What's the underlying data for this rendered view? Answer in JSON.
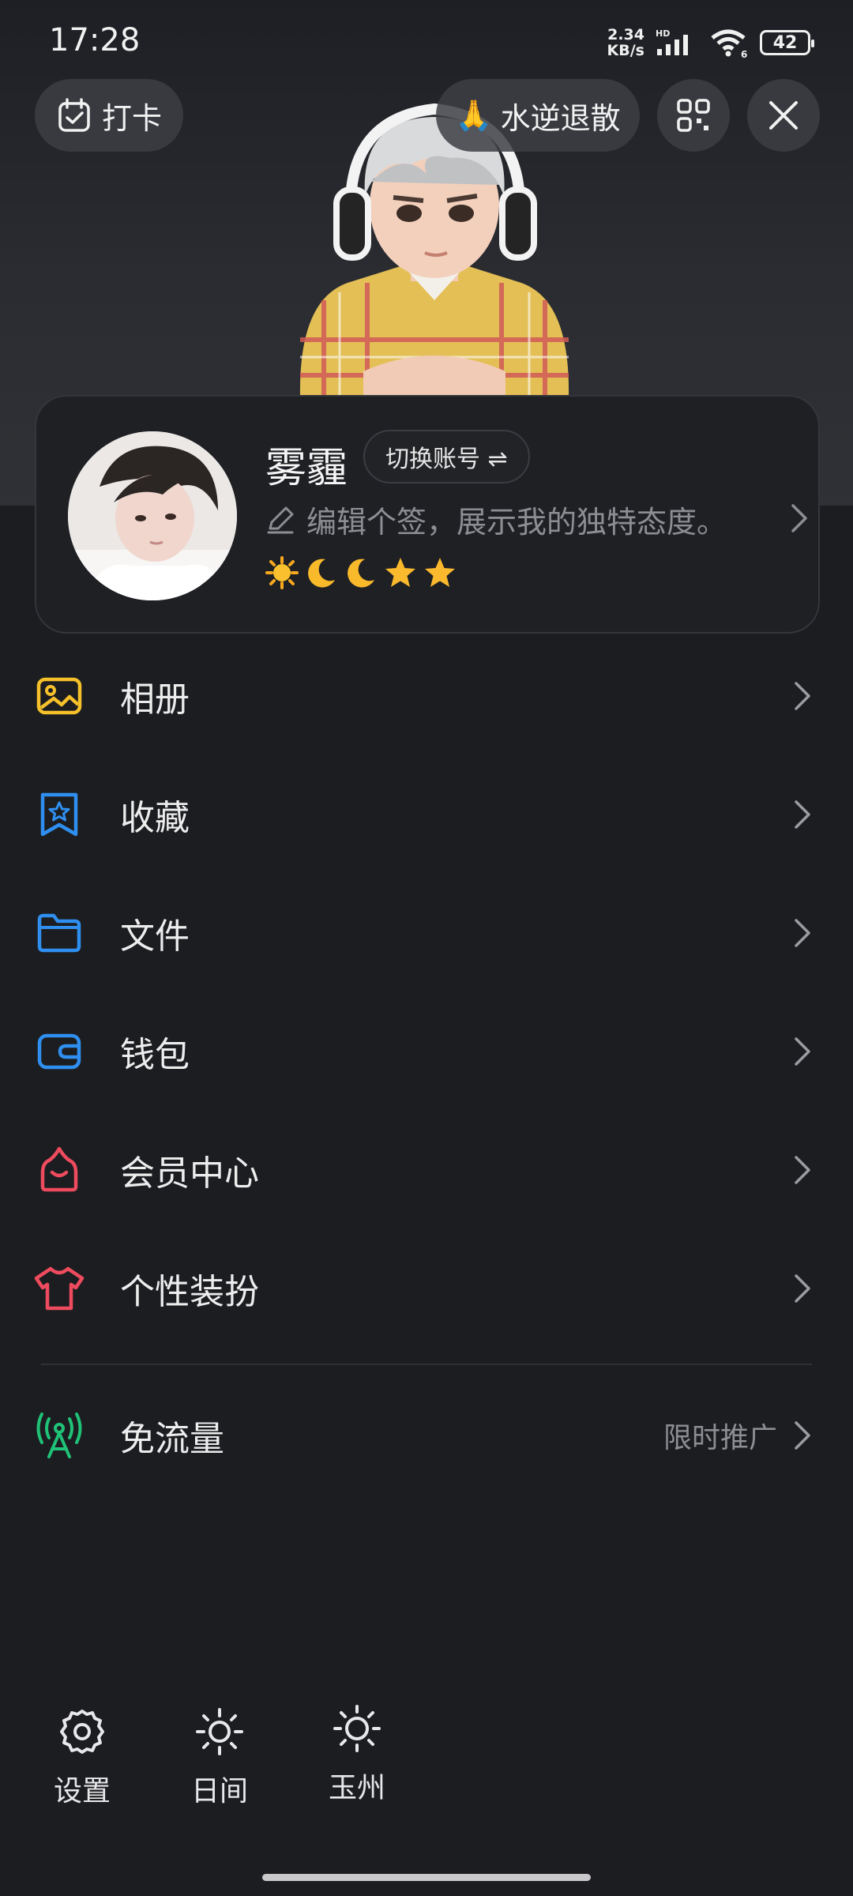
{
  "status_bar": {
    "time": "17:28",
    "net_speed_value": "2.34",
    "net_speed_unit": "KB/s",
    "hd": "HD",
    "wifi_num": "6",
    "battery": "42"
  },
  "top_actions": {
    "checkin_label": "打卡",
    "status_emoji": "🙏",
    "status_label": "水逆退散"
  },
  "profile": {
    "nickname": "雾霾",
    "switch_account_label": "切换账号 ⇌",
    "signature_placeholder": "编辑个签，展示我的独特态度。",
    "badges": [
      "sun",
      "moon",
      "moon",
      "star",
      "star"
    ]
  },
  "menu": [
    {
      "label": "相册",
      "icon": "album-icon",
      "color": "#f5c02a"
    },
    {
      "label": "收藏",
      "icon": "favorites-icon",
      "color": "#2f8ff0"
    },
    {
      "label": "文件",
      "icon": "folder-icon",
      "color": "#2f8ff0"
    },
    {
      "label": "钱包",
      "icon": "wallet-icon",
      "color": "#2f8ff0"
    },
    {
      "label": "会员中心",
      "icon": "vip-icon",
      "color": "#ee4b5e"
    },
    {
      "label": "个性装扮",
      "icon": "tshirt-icon",
      "color": "#ee4b5e"
    }
  ],
  "free_traffic": {
    "label": "免流量",
    "extra": "限时推广",
    "icon": "antenna-icon",
    "color": "#1fc277"
  },
  "bottom": [
    {
      "label": "设置",
      "icon": "gear-icon"
    },
    {
      "label": "日间",
      "icon": "sun-icon"
    },
    {
      "label": "玉州",
      "icon": "weather-sun-icon"
    }
  ],
  "colors": {
    "background": "#1c1d20",
    "text": "#ededee",
    "muted": "#8c8e93"
  }
}
